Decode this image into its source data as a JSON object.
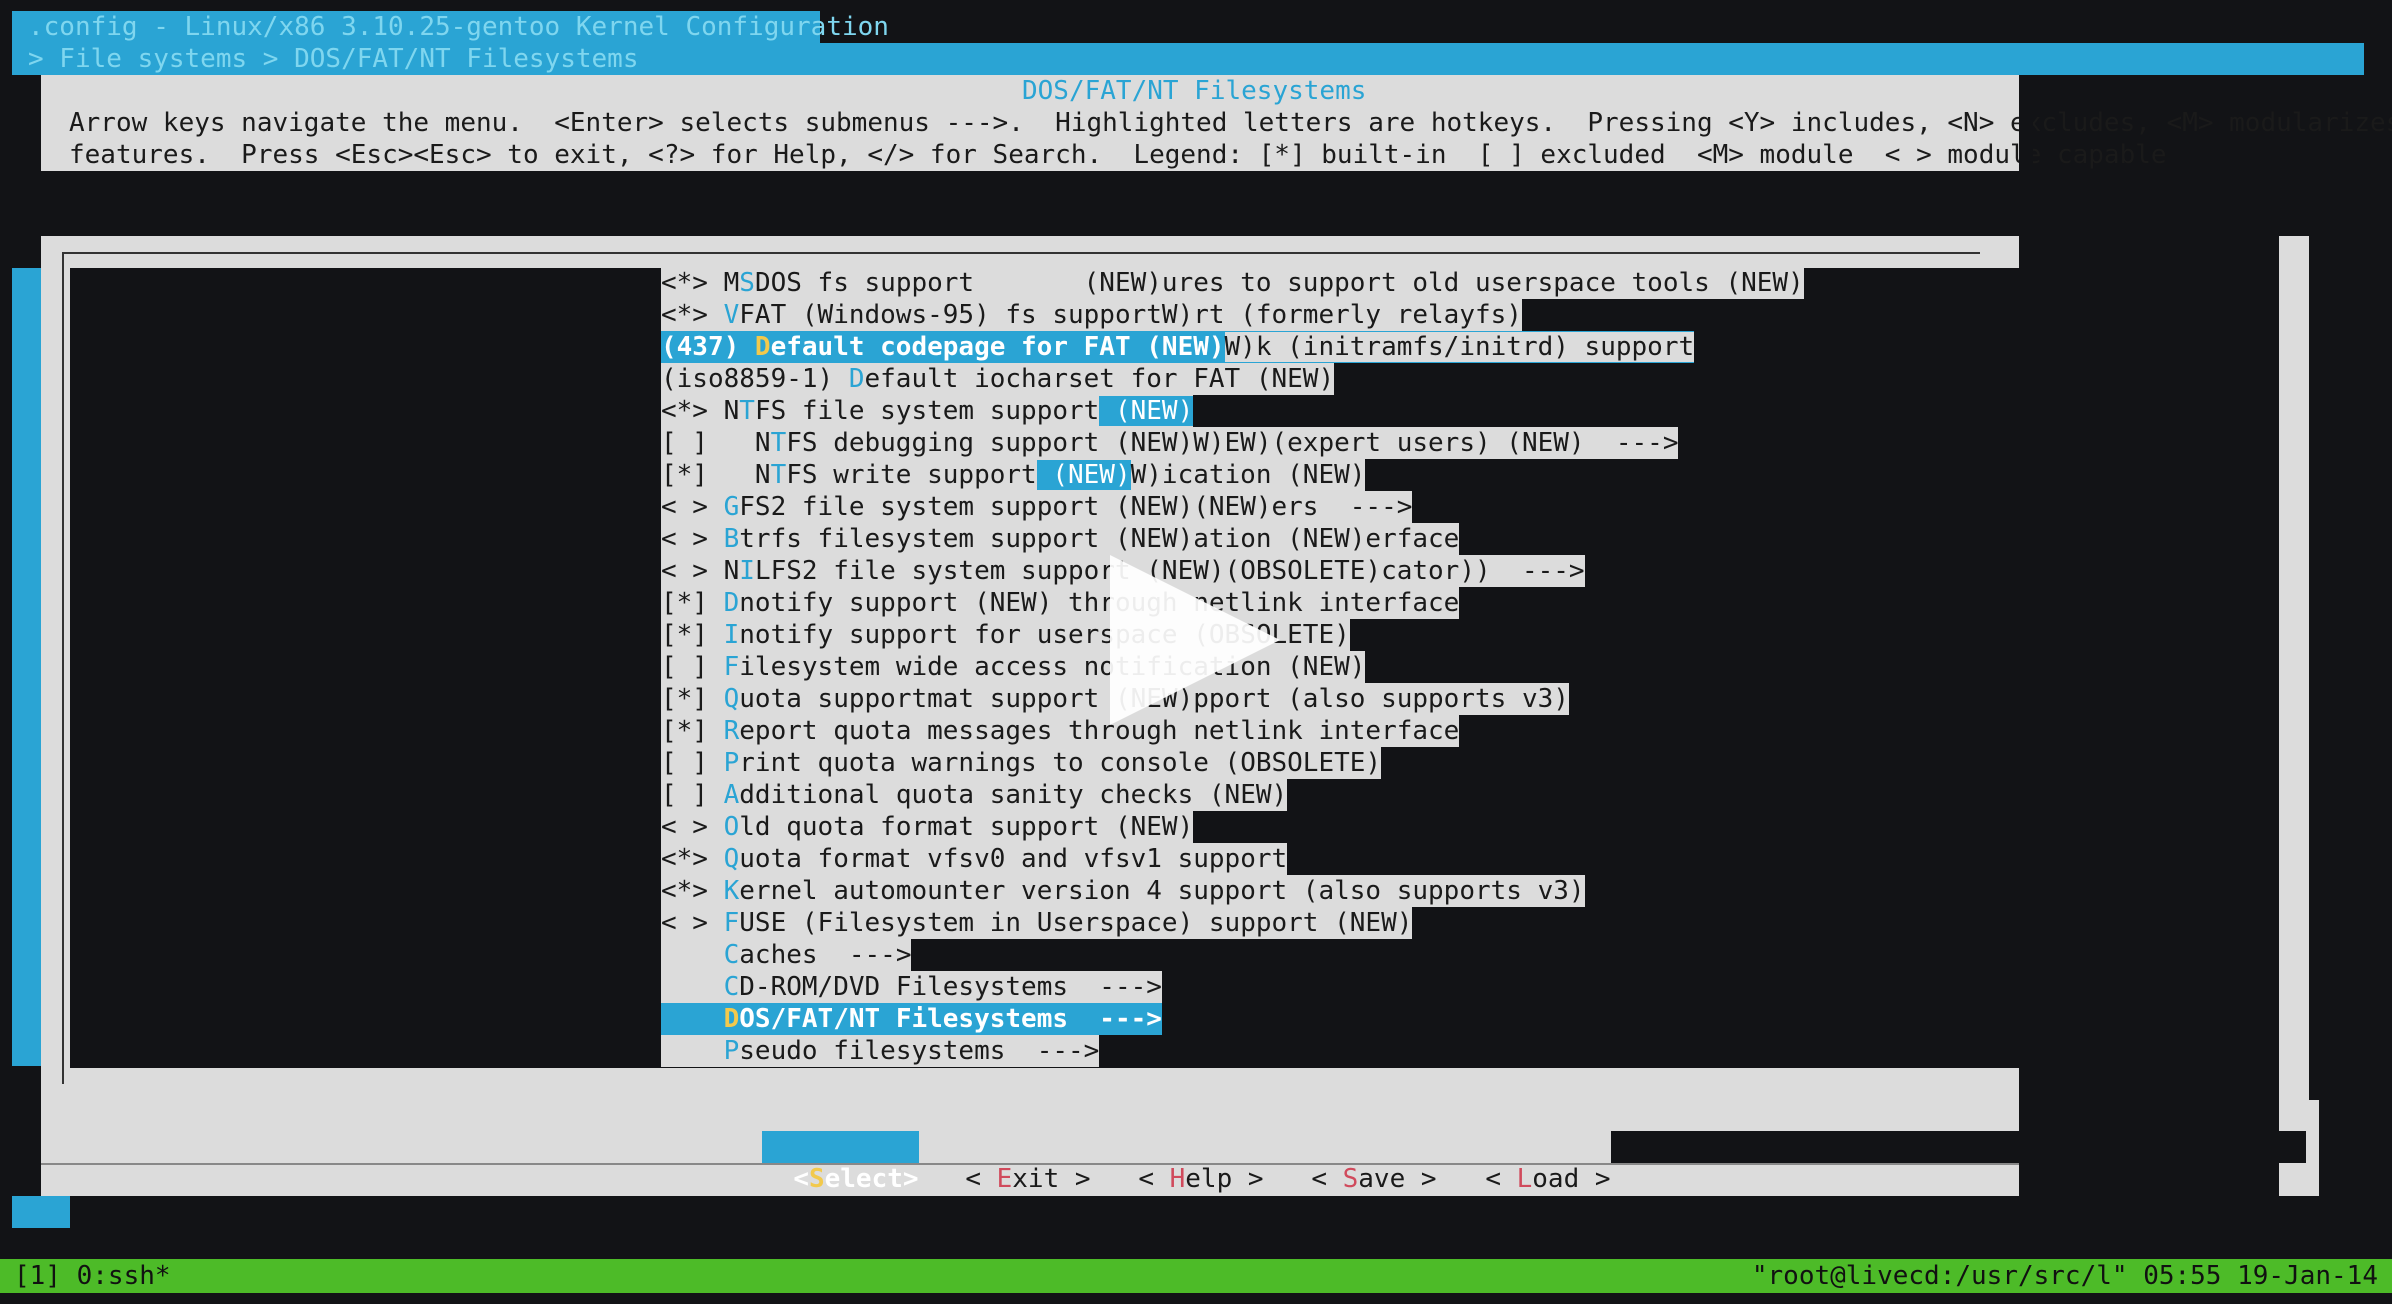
{
  "window": {
    "title": ".config - Linux/x86 3.10.25-gentoo Kernel Configuration",
    "breadcrumb": "> File systems > DOS/FAT/NT Filesystems"
  },
  "dialog": {
    "title": "DOS/FAT/NT Filesystems",
    "help_line1": "Arrow keys navigate the menu.  <Enter> selects submenus --->.  Highlighted letters are hotkeys.  Pressing <Y> includes, <N> excludes, <M> modularizes",
    "help_line2": "features.  Press <Esc><Esc> to exit, <?> for Help, </> for Search.  Legend: [*] built-in  [ ] excluded  <M> module  < > module capable"
  },
  "menu": [
    {
      "pre": "<*> M",
      "hot": "S",
      "post": "DOS fs support       (NEW)ures to support old userspace tools (NEW)"
    },
    {
      "pre": "<*> ",
      "hot": "V",
      "post": "FAT (Windows-95) fs supportW)rt (formerly relayfs)"
    },
    {
      "pre": "(437) ",
      "hot": "D",
      "post": "efault codepage for FAT (NEW)",
      "tail": "W)k (initramfs/initrd) support",
      "selected": true
    },
    {
      "pre": "(iso8859-1) ",
      "hot": "D",
      "post": "efault iocharset for FAT (NEW)"
    },
    {
      "pre": "<*> N",
      "hot": "T",
      "post": "FS file system support",
      "hl": " (NEW)"
    },
    {
      "pre": "[ ]   N",
      "hot": "T",
      "post": "FS debugging support (NEW)W)EW)(expert users) (NEW)  --->"
    },
    {
      "pre": "[*]   N",
      "hot": "T",
      "post": "FS write support",
      "hl": " (NEW)",
      "tail": "W)ication (NEW)"
    },
    {
      "pre": "< > ",
      "hot": "G",
      "post": "FS2 file system support (NEW)(NEW)ers  --->"
    },
    {
      "pre": "< > ",
      "hot": "B",
      "post": "trfs filesystem support (NEW)ation (NEW)erface"
    },
    {
      "pre": "< > N",
      "hot": "I",
      "post": "LFS2 file system support (NEW)(OBSOLETE)cator))  --->"
    },
    {
      "pre": "[*] ",
      "hot": "D",
      "post": "notify support (NEW) through netlink interface"
    },
    {
      "pre": "[*] ",
      "hot": "I",
      "post": "notify support for userspace (OBSOLETE)"
    },
    {
      "pre": "[ ] ",
      "hot": "F",
      "post": "ilesystem wide access notification (NEW)"
    },
    {
      "pre": "[*] ",
      "hot": "Q",
      "post": "uota supportmat support (NEW)pport (also supports v3)"
    },
    {
      "pre": "[*] ",
      "hot": "R",
      "post": "eport quota messages through netlink interface"
    },
    {
      "pre": "[ ] ",
      "hot": "P",
      "post": "rint quota warnings to console (OBSOLETE)"
    },
    {
      "pre": "[ ] ",
      "hot": "A",
      "post": "dditional quota sanity checks (NEW)"
    },
    {
      "pre": "< > ",
      "hot": "O",
      "post": "ld quota format support (NEW)"
    },
    {
      "pre": "<*> ",
      "hot": "Q",
      "post": "uota format vfsv0 and vfsv1 support"
    },
    {
      "pre": "<*> ",
      "hot": "K",
      "post": "ernel automounter version 4 support (also supports v3)"
    },
    {
      "pre": "< > ",
      "hot": "F",
      "post": "USE (Filesystem in Userspace) support (NEW)"
    },
    {
      "pre": "    ",
      "hot": "C",
      "post": "aches  --->"
    },
    {
      "pre": "    ",
      "hot": "C",
      "post": "D-ROM/DVD Filesystems  --->"
    },
    {
      "pre": "    ",
      "hot": "D",
      "post": "OS/FAT/NT Filesystems  --->",
      "selected": true
    },
    {
      "pre": "    ",
      "hot": "P",
      "post": "seudo filesystems  --->"
    }
  ],
  "buttons": {
    "select": {
      "open": "<",
      "hot": "S",
      "rest": "elect",
      "close": ">"
    },
    "exit": {
      "open": "< ",
      "hot": "E",
      "rest": "xit",
      "close": " >"
    },
    "help": {
      "open": "< ",
      "hot": "H",
      "rest": "elp",
      "close": " >"
    },
    "save": {
      "open": "< ",
      "hot": "S",
      "rest": "ave",
      "close": " >"
    },
    "load": {
      "open": "< ",
      "hot": "L",
      "rest": "oad",
      "close": " >"
    }
  },
  "status": {
    "left": "[1] 0:ssh*",
    "right": "\"root@livecd:/usr/src/l\" 05:55 19-Jan-14"
  },
  "colors": {
    "accent": "#2aa4d4",
    "status_bar": "#4dbb28",
    "dialog_bg": "#dcdcdc",
    "terminal_bg": "#121316",
    "button_hotkey": "#d04a5c"
  },
  "icons": {
    "play_overlay": "play-icon"
  }
}
